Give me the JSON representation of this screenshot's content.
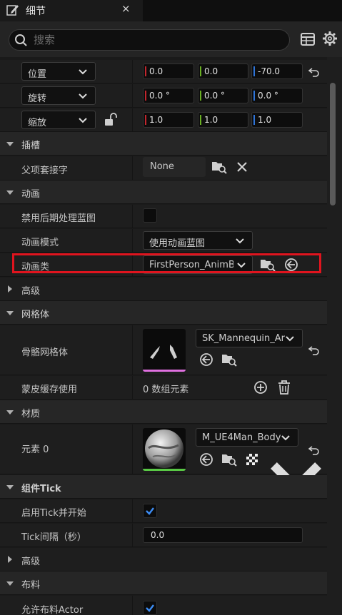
{
  "tab": {
    "title": "细节",
    "close": "×",
    "icon": "pencil-icon"
  },
  "search": {
    "placeholder": "搜索"
  },
  "transform": {
    "location": {
      "label": "位置",
      "x": "0.0",
      "y": "0.0",
      "z": "-70.0"
    },
    "rotation": {
      "label": "旋转",
      "x": "0.0 °",
      "y": "0.0 °",
      "z": "0.0 °"
    },
    "scale": {
      "label": "缩放",
      "x": "1.0",
      "y": "1.0",
      "z": "1.0"
    }
  },
  "sockets": {
    "title": "插槽",
    "parent_socket": {
      "label": "父项套接字",
      "value": "None"
    }
  },
  "animation": {
    "title": "动画",
    "disable_post_process": {
      "label": "禁用后期处理蓝图"
    },
    "mode": {
      "label": "动画模式",
      "value": "使用动画蓝图"
    },
    "anim_class": {
      "label": "动画类",
      "value": "FirstPerson_AnimBP"
    },
    "advanced": "高级"
  },
  "mesh": {
    "title": "网格体",
    "skeletal_mesh": {
      "label": "骨骼网格体",
      "value": "SK_Mannequin_Arms"
    },
    "skin_cache": {
      "label": "蒙皮缓存使用",
      "value": "0 数组元素"
    }
  },
  "materials": {
    "title": "材质",
    "element0": {
      "label": "元素 0",
      "value": "M_UE4Man_Body"
    }
  },
  "component_tick": {
    "title": "组件Tick",
    "start_with_tick": {
      "label": "启用Tick并开始"
    },
    "tick_interval": {
      "label": "Tick间隔（秒）",
      "value": "0.0"
    },
    "advanced": "高级"
  },
  "cloth": {
    "title": "布料",
    "allow_cloth": {
      "label": "允许布料Actor"
    }
  },
  "colors": {
    "x_axis": "#c4262e",
    "y_axis": "#6ab023",
    "z_axis": "#2e74d8",
    "highlight": "#e0141e",
    "checkbox_check": "#3d8df5"
  }
}
